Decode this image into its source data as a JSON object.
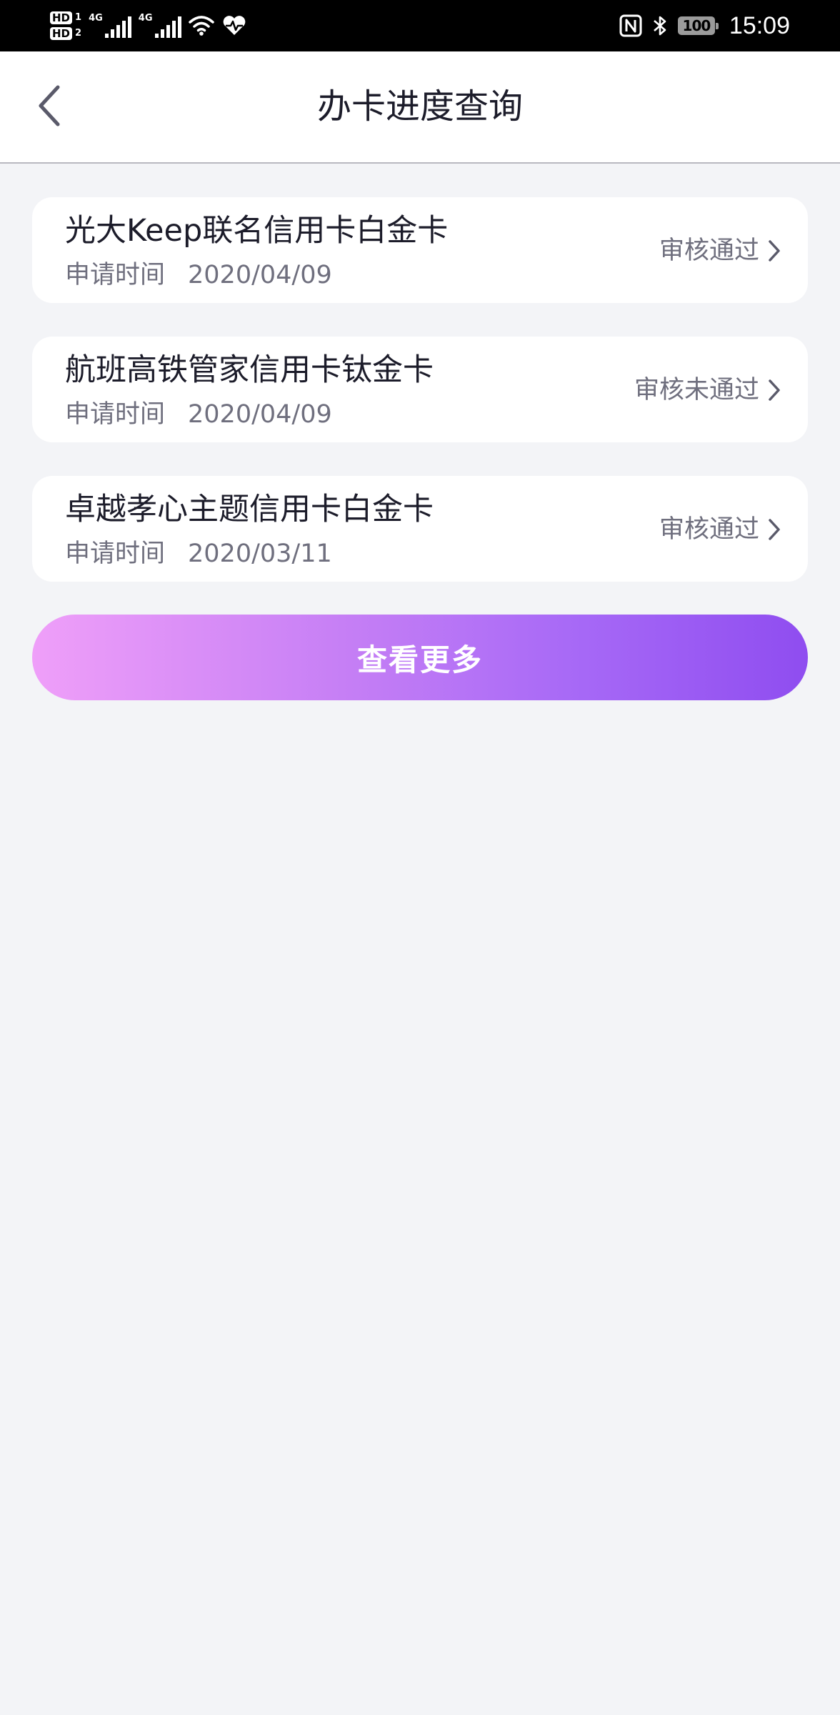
{
  "status_bar": {
    "hd1": "HD",
    "hd1_sub": "1",
    "hd2": "HD",
    "hd2_sub": "2",
    "net1": "4G",
    "net2": "4G",
    "battery": "100",
    "time": "15:09",
    "icons": [
      "signal-icon",
      "wifi-icon",
      "heart-rate-icon",
      "nfc-icon",
      "bluetooth-icon",
      "battery-icon"
    ]
  },
  "header": {
    "title": "办卡进度查询",
    "back_icon": "chevron-left-icon"
  },
  "applications": [
    {
      "name": "光大Keep联名信用卡白金卡",
      "time_label": "申请时间",
      "date": "2020/04/09",
      "status": "审核通过"
    },
    {
      "name": "航班高铁管家信用卡钛金卡",
      "time_label": "申请时间",
      "date": "2020/04/09",
      "status": "审核未通过"
    },
    {
      "name": "卓越孝心主题信用卡白金卡",
      "time_label": "申请时间",
      "date": "2020/03/11",
      "status": "审核通过"
    }
  ],
  "more_button": {
    "label": "查看更多",
    "gradient_start": "#ef9ff9",
    "gradient_end": "#8f4df0"
  },
  "colors": {
    "background": "#f3f4f7",
    "title_text": "#1c1c2a",
    "secondary_text": "#6f6f7e"
  }
}
